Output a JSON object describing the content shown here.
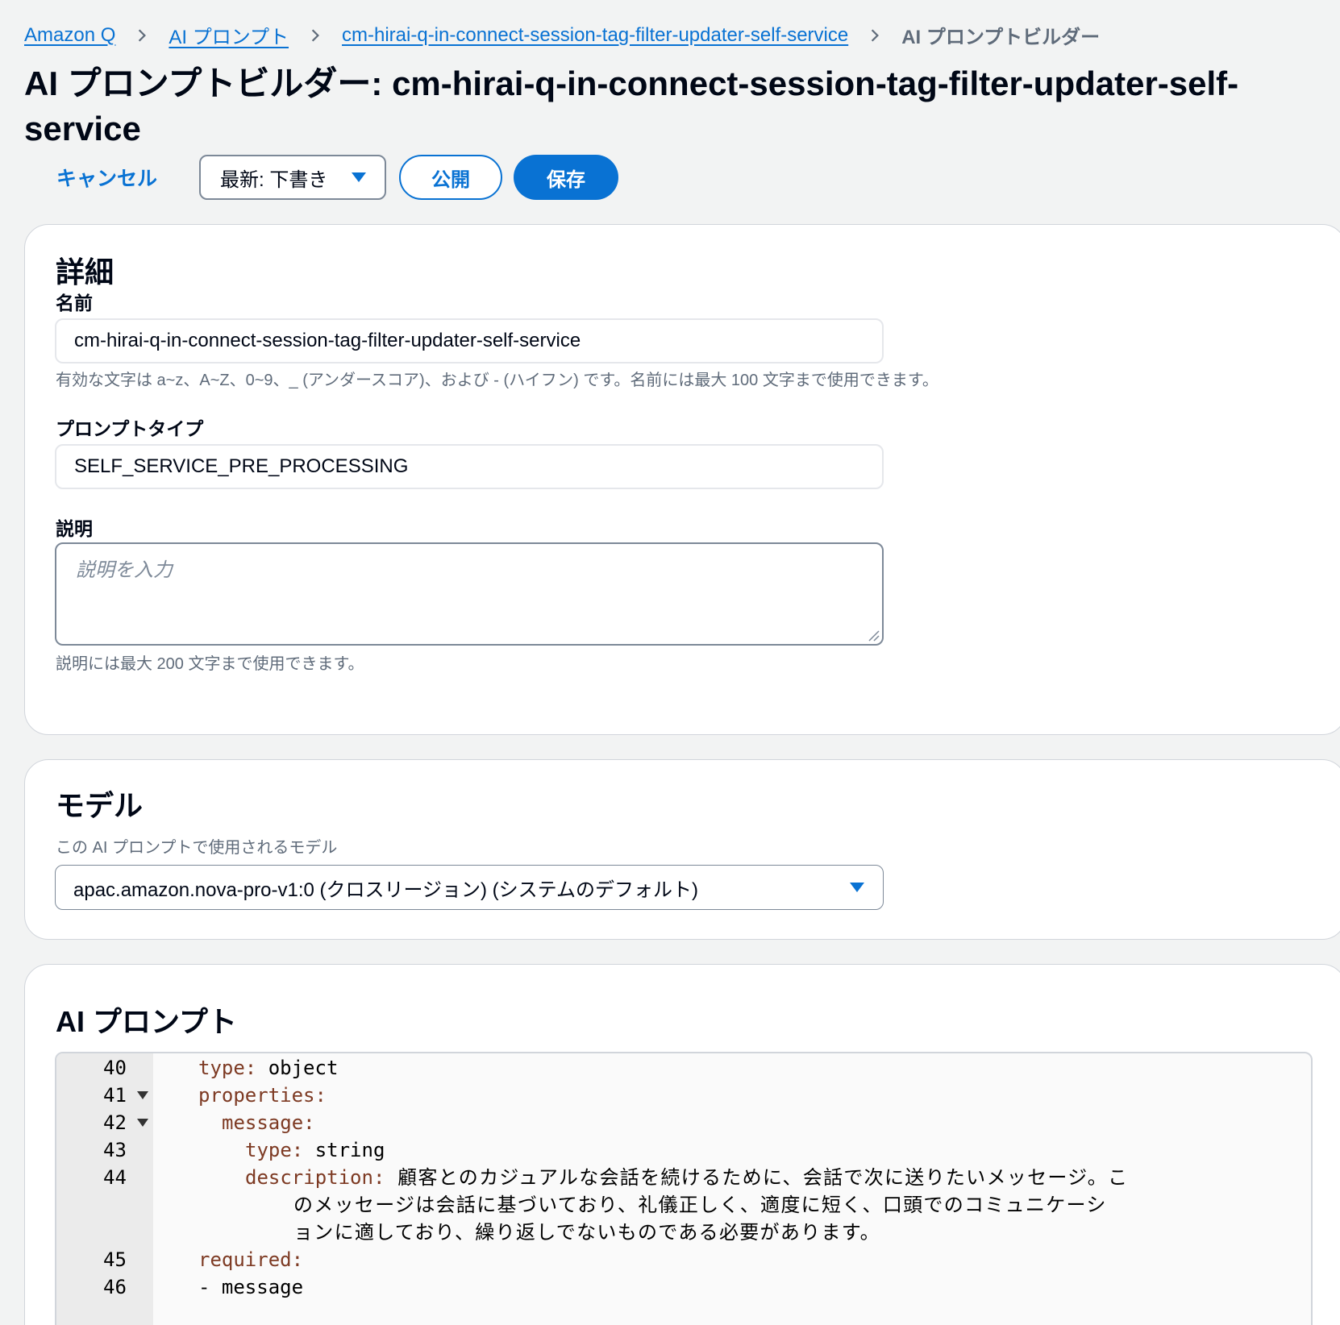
{
  "breadcrumb": {
    "items": [
      "Amazon Q",
      "AI プロンプト",
      "cm-hirai-q-in-connect-session-tag-filter-updater-self-service"
    ],
    "current": "AI プロンプトビルダー"
  },
  "page": {
    "title": "AI プロンプトビルダー: cm-hirai-q-in-connect-session-tag-filter-updater-self-service"
  },
  "actions": {
    "cancel": "キャンセル",
    "version_select": "最新: 下書き",
    "publish": "公開",
    "save": "保存"
  },
  "details": {
    "title": "詳細",
    "name_label": "名前",
    "name_value": "cm-hirai-q-in-connect-session-tag-filter-updater-self-service",
    "name_hint": "有効な文字は a~z、A~Z、0~9、_ (アンダースコア)、および - (ハイフン) です。名前には最大 100 文字まで使用できます。",
    "type_label": "プロンプトタイプ",
    "type_value": "SELF_SERVICE_PRE_PROCESSING",
    "desc_label": "説明",
    "desc_placeholder": "説明を入力",
    "desc_hint": "説明には最大 200 文字まで使用できます。"
  },
  "model": {
    "title": "モデル",
    "description": "この AI プロンプトで使用されるモデル",
    "selected": "apac.amazon.nova-pro-v1:0 (クロスリージョン) (システムのデフォルト)"
  },
  "prompt": {
    "title": "AI プロンプト",
    "lines": [
      {
        "num": "40",
        "key": "type:",
        "value": " object"
      },
      {
        "num": "41",
        "key": "properties:",
        "value": ""
      },
      {
        "num": "42",
        "key": "message:",
        "value": ""
      },
      {
        "num": "43",
        "key": "type:",
        "value": " string"
      },
      {
        "num": "44",
        "key": "description:",
        "value": " 顧客とのカジュアルな会話を続けるために、会話で次に送りたいメッセージ。こ"
      },
      {
        "num": "",
        "key": "",
        "value": "のメッセージは会話に基づいており、礼儀正しく、適度に短く、口頭でのコミュニケーシ"
      },
      {
        "num": "",
        "key": "",
        "value": "ョンに適しており、繰り返しでないものである必要があります。"
      },
      {
        "num": "45",
        "key": "required:",
        "value": ""
      },
      {
        "num": "46",
        "key": "",
        "value": "- message"
      }
    ]
  }
}
